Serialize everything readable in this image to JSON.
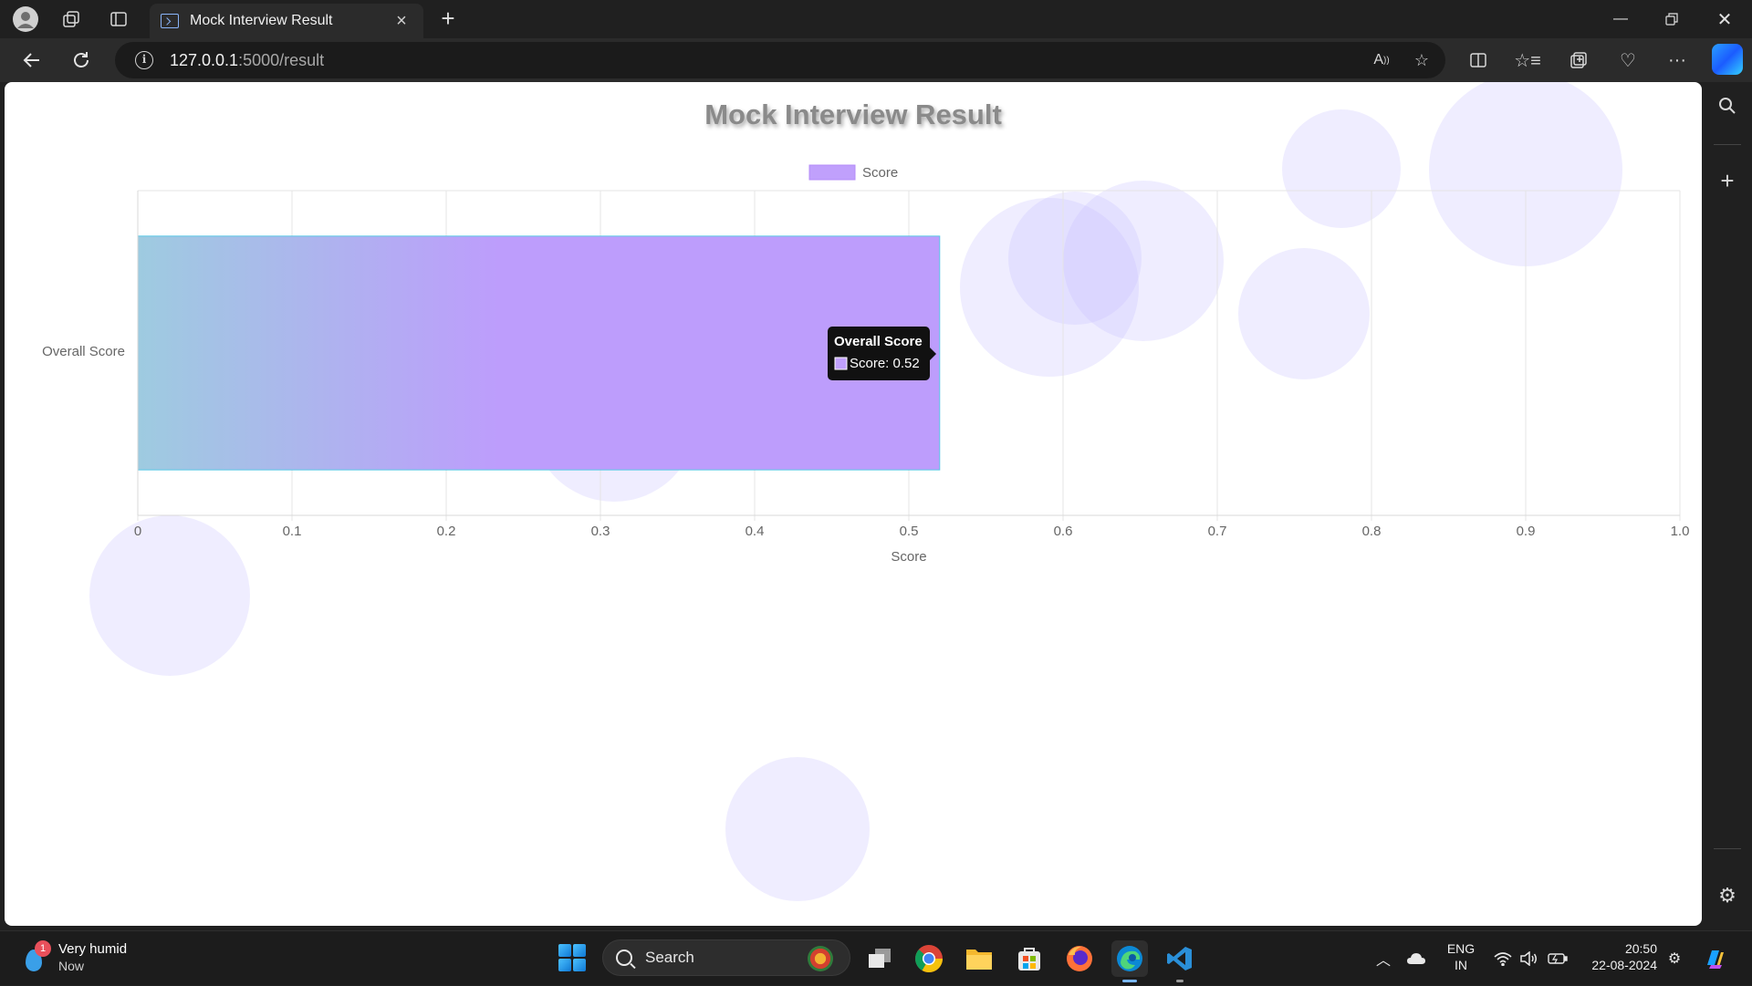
{
  "browser": {
    "tab_title": "Mock Interview Result",
    "url_host": "127.0.0.1",
    "url_path": ":5000/result"
  },
  "page": {
    "title": "Mock Interview Result"
  },
  "chart_data": {
    "type": "bar",
    "orientation": "horizontal",
    "categories": [
      "Overall Score"
    ],
    "series": [
      {
        "name": "Score",
        "values": [
          0.52
        ]
      }
    ],
    "title": "",
    "xlabel": "Score",
    "ylabel": "",
    "xlim": [
      0,
      1.0
    ],
    "x_ticks": [
      "0",
      "0.1",
      "0.2",
      "0.3",
      "0.4",
      "0.5",
      "0.6",
      "0.7",
      "0.8",
      "0.9",
      "1.0"
    ],
    "grid": true,
    "legend_position": "top",
    "colors": {
      "bar_start": "#9ecbe0",
      "bar_end": "#bd9dfc",
      "bar_border": "#5ac8e6",
      "legend_fill": "#c0a0fc"
    },
    "tooltip": {
      "title": "Overall Score",
      "label": "Score: 0.52"
    }
  },
  "taskbar": {
    "weather_title": "Very humid",
    "weather_sub": "Now",
    "weather_badge": "1",
    "search_label": "Search",
    "lang_1": "ENG",
    "lang_2": "IN",
    "time": "20:50",
    "date": "22-08-2024"
  }
}
